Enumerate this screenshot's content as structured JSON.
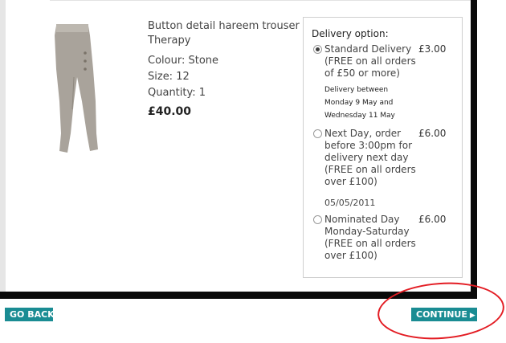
{
  "product": {
    "name": "Button detail hareem trouser",
    "brand": "Therapy",
    "colour": "Colour: Stone",
    "size": "Size: 12",
    "quantity": "Quantity: 1",
    "price": "£40.00",
    "image_icon": "trouser-product-image"
  },
  "delivery": {
    "heading": "Delivery option:",
    "options": [
      {
        "label": "Standard Delivery\n(FREE on all orders\nof £50 or more)",
        "price": "£3.00",
        "selected": true,
        "note": "Delivery between\nMonday 9 May and\nWednesday 11 May"
      },
      {
        "label": "Next Day, order\nbefore 3:00pm for\ndelivery next day\n(FREE on all orders\nover £100)",
        "price": "£6.00",
        "selected": false,
        "date": "05/05/2011"
      },
      {
        "label": "Nominated Day\nMonday-Saturday\n(FREE on all orders\nover £100)",
        "price": "£6.00",
        "selected": false
      }
    ]
  },
  "buttons": {
    "back": "GO BACK",
    "continue": "CONTINUE",
    "continue_icon": "play-arrow-icon"
  },
  "colors": {
    "button": "#1a8c93",
    "highlight": "#e31c23",
    "frame": "#0a0a0a"
  }
}
